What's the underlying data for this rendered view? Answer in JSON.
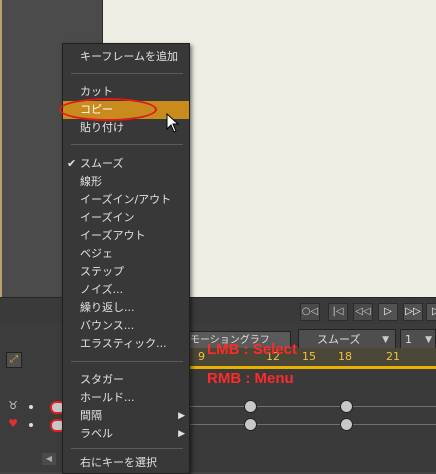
{
  "menu": {
    "items": [
      {
        "label": "キーフレームを追加"
      },
      {
        "label": "カット"
      },
      {
        "label": "コピー"
      },
      {
        "label": "貼り付け"
      },
      {
        "label": "スムーズ"
      },
      {
        "label": "線形"
      },
      {
        "label": "イーズイン/アウト"
      },
      {
        "label": "イーズイン"
      },
      {
        "label": "イーズアウト"
      },
      {
        "label": "ベジェ"
      },
      {
        "label": "ステップ"
      },
      {
        "label": "ノイズ..."
      },
      {
        "label": "繰り返し..."
      },
      {
        "label": "バウンス..."
      },
      {
        "label": "エラスティック..."
      },
      {
        "label": "スタガー"
      },
      {
        "label": "ホールド..."
      },
      {
        "label": "間隔"
      },
      {
        "label": "ラベル"
      },
      {
        "label": "右にキーを選択"
      }
    ],
    "highlighted": "コピー",
    "checked": "スムーズ"
  },
  "transport": {
    "buttons": [
      "○◁",
      "|◁",
      "◁◁",
      "▷",
      "▷▷",
      "▷"
    ]
  },
  "toolbar": {
    "motion_graph_label": "モーショングラフ",
    "interpolation_select": "スムーズ",
    "step_select": "1"
  },
  "ruler": {
    "ticks": [
      "9",
      "12",
      "15",
      "18",
      "21"
    ]
  },
  "annotations": {
    "lmb": "LMB : Select",
    "rmb": "RMB : Menu"
  },
  "colors": {
    "menu_highlight": "#c98b1c",
    "annotation_red": "#ff2a2a",
    "ruler_yellow": "#e8b100"
  }
}
